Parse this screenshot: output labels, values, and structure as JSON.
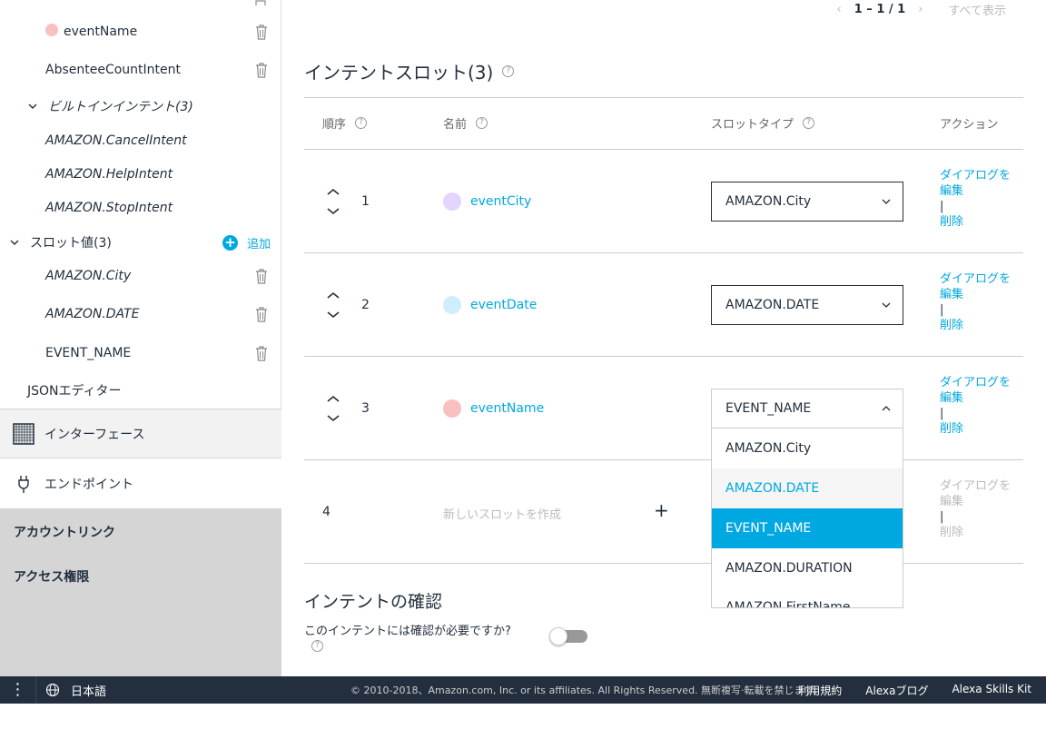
{
  "sidebar": {
    "items": [
      {
        "label": "eventName",
        "dot_color": "#f9c0c0"
      },
      {
        "label": "AbsenteeCountIntent"
      },
      {
        "label": "ビルトインインテント(3)"
      },
      {
        "label": "AMAZON.CancelIntent"
      },
      {
        "label": "AMAZON.HelpIntent"
      },
      {
        "label": "AMAZON.StopIntent"
      }
    ],
    "slot_values_header": "スロット値(3)",
    "add_label": "追加",
    "slot_values": [
      {
        "label": "AMAZON.City"
      },
      {
        "label": "AMAZON.DATE"
      },
      {
        "label": "EVENT_NAME"
      }
    ],
    "json_editor": "JSONエディター",
    "interface": "インターフェース",
    "endpoint": "エンドポイント",
    "account_link": "アカウントリンク",
    "permissions": "アクセス権限"
  },
  "pager": {
    "range": "1 – 1 / 1",
    "show_all": "すべて表示"
  },
  "slots": {
    "title": "インテントスロット(3)",
    "columns": {
      "order": "順序",
      "name": "名前",
      "slot_type": "スロットタイプ",
      "action": "アクション"
    },
    "rows": [
      {
        "num": "1",
        "name": "eventCity",
        "dot_color": "#e3d5fb",
        "type": "AMAZON.City"
      },
      {
        "num": "2",
        "name": "eventDate",
        "dot_color": "#cfeefc",
        "type": "AMAZON.DATE"
      },
      {
        "num": "3",
        "name": "eventName",
        "dot_color": "#f9c0c0",
        "type": "EVENT_NAME"
      }
    ],
    "action_edit": "ダイアログを編集",
    "action_sep": "|",
    "action_delete": "削除",
    "new_row": {
      "num": "4",
      "placeholder": "新しいスロットを作成",
      "plus": "+"
    },
    "dropdown_options": [
      "AMAZON.City",
      "AMAZON.DATE",
      "EVENT_NAME",
      "AMAZON.DURATION",
      "AMAZON.FirstName"
    ],
    "dropdown_selected": "EVENT_NAME",
    "dropdown_hovered": "AMAZON.DATE"
  },
  "confirmation": {
    "title": "インテントの確認",
    "question": "このインテントには確認が必要ですか?",
    "toggle_on": false
  },
  "footer": {
    "language": "日本語",
    "copyright": "© 2010-2018、Amazon.com, Inc. or its affiliates. All Rights Reserved. 無断複写·転載を禁じます。",
    "links": [
      "利用規約",
      "Alexaブログ",
      "Alexa Skills Kit"
    ]
  },
  "colors": {
    "accent": "#00a8e1",
    "footer_bg": "#232f3e"
  }
}
